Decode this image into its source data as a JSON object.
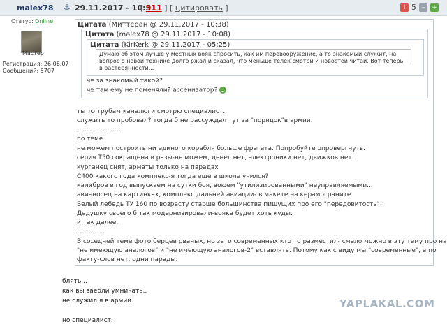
{
  "header": {
    "username": "malex78",
    "date": "29.11.2017 - 10:51",
    "post_num": "911",
    "quote_label": "цитировать",
    "bracket_open": "[",
    "bracket_mid": "] [",
    "bracket_close": "]",
    "count": "5"
  },
  "sidebar": {
    "status_label": "Статус:",
    "status_value": "Online",
    "rank": "Мастер",
    "registration": "Регистрация: 26.06.07",
    "messages": "Сообщений: 5707"
  },
  "quote1": {
    "label": "Цитата",
    "meta": "(Миттеран @ 29.11.2017 - 10:38)",
    "quote2": {
      "label": "Цитата",
      "meta": "(malex78 @ 29.11.2017 - 10:08)",
      "quote3": {
        "label": "Цитата",
        "meta": "(KirKerk @ 29.11.2017 - 05:25)",
        "text": "Думаю об этом лучше у местных вояк спросить, как им перевооружение, а то знакомый служит, на вопрос о новой технике долго ржал и сказал, что меньше телек смотри и новостей читай. Вот теперь в растерянности..."
      },
      "lines": [
        "че за знакомый такой?",
        "че там ему не поменяли? ассенизатор?"
      ]
    },
    "lines": [
      "ты то трубам каналюги смотрю специалист.",
      "служить то пробовал? тогда б не рассуждал тут за \"порядок\"в армии.",
      "......................",
      "по теме.",
      "не можем построить ни единого корабля больше фрегата. Попробуйте опровергнуть.",
      "серия Т50 сокращена в разы-не можем, денег нет, электроники нет, движков нет.",
      "курганец снят, арматы только на парадах",
      "С400 какого года комплекс-я тогда еще в школе учился?",
      "калибров в год выпускаем на сутки боя, воюем \"утилизированными\" неуправляемыми...",
      "авианосец на картинках, комплекс дальней авиации- в макете на керамограните",
      "Белый лебедь ТУ 160 по возрасту старше большинства пишущих про его \"передовитость\".",
      "Дедушку своего б так модернизировали-вояка будет хоть куды.",
      "и так далее.",
      "...............",
      "В соседней теме фото берцев рваных, но зато современных кто то разместил- смело можно в эту тему про нашу",
      "\"не имеющую аналогов\" и \"не имеющую аналогов-2\" вставлять. Потому как с виду мы \"современные\", а по",
      "факту-слов нет, одни парады."
    ]
  },
  "body_lines": [
    "блять...",
    "как вы заебли умничать..",
    "не служил я в армии.",
    "",
    "но специалист."
  ],
  "logo": "YAPLAKAL.COM"
}
